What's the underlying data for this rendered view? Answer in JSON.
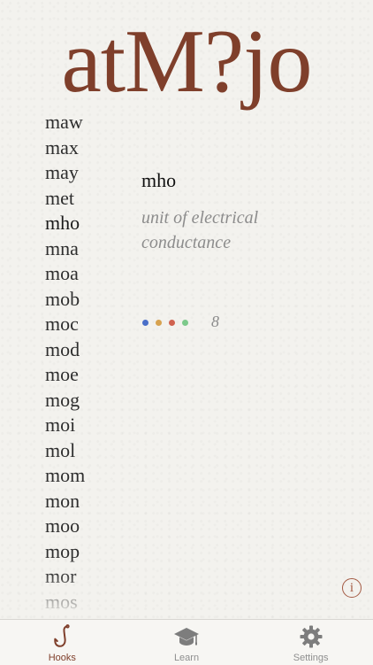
{
  "app": {
    "title": "atM?jo"
  },
  "word_list": [
    "maw",
    "max",
    "may",
    "met",
    "mho",
    "mna",
    "moa",
    "mob",
    "moc",
    "mod",
    "moe",
    "mog",
    "moi",
    "mol",
    "mom",
    "mon",
    "moo",
    "mop",
    "mor",
    "mos"
  ],
  "selected_index": 4,
  "detail": {
    "word": "mho",
    "definition": "unit of  electrical conductance",
    "score": "8",
    "dots": [
      "#4a6fc8",
      "#d7a24f",
      "#d0624f",
      "#7cc98a"
    ]
  },
  "info_button": {
    "label": "i"
  },
  "tabs": [
    {
      "label": "Hooks",
      "icon": "hook-icon",
      "active": true
    },
    {
      "label": "Learn",
      "icon": "graduation-cap-icon",
      "active": false
    },
    {
      "label": "Settings",
      "icon": "gear-icon",
      "active": false
    }
  ],
  "colors": {
    "accent": "#7f3f2b",
    "inactive": "#8e8e8e"
  }
}
